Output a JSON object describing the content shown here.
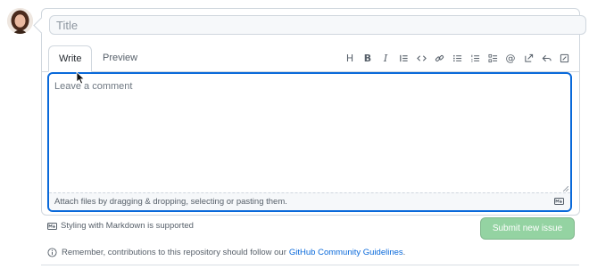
{
  "title_field": {
    "placeholder": "Title",
    "value": ""
  },
  "tabs": [
    {
      "label": "Write",
      "active": true
    },
    {
      "label": "Preview",
      "active": false
    }
  ],
  "toolbar": {
    "buttons": [
      {
        "name": "heading",
        "glyph": "H"
      },
      {
        "name": "bold",
        "glyph": "B"
      },
      {
        "name": "italic",
        "glyph": "I"
      },
      {
        "name": "quote",
        "icon": "quote-icon"
      },
      {
        "name": "code",
        "icon": "code-icon"
      },
      {
        "name": "link",
        "icon": "link-icon"
      },
      {
        "name": "bulleted-list",
        "icon": "unordered-list-icon"
      },
      {
        "name": "numbered-list",
        "icon": "ordered-list-icon"
      },
      {
        "name": "task-list",
        "icon": "tasklist-icon"
      },
      {
        "name": "mention",
        "glyph": "@"
      },
      {
        "name": "cross-reference",
        "icon": "cross-reference-icon"
      },
      {
        "name": "saved-reply",
        "icon": "reply-icon"
      },
      {
        "name": "fullscreen",
        "icon": "fullscreen-icon"
      }
    ]
  },
  "comment_field": {
    "placeholder": "Leave a comment",
    "value": ""
  },
  "attach_text": "Attach files by dragging & dropping, selecting or pasting them.",
  "markdown_note": "Styling with Markdown is supported",
  "submit_label": "Submit new issue",
  "guideline": {
    "prefix": "Remember, contributions to this repository should follow our",
    "link": "GitHub Community Guidelines",
    "suffix": "."
  },
  "colors": {
    "accent": "#0969da",
    "submit_disabled": "#94d3a2",
    "border": "#d0d7de"
  }
}
